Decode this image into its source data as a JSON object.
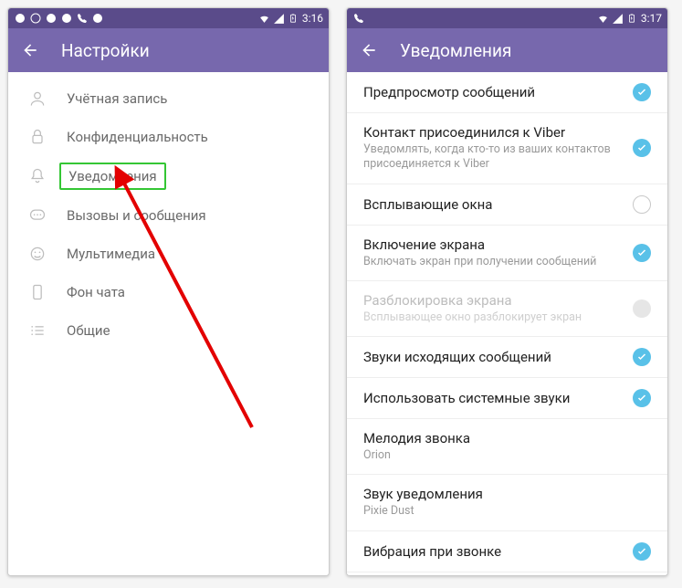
{
  "left": {
    "status_time": "3:16",
    "title": "Настройки",
    "items": [
      {
        "icon": "user",
        "label": "Учётная запись"
      },
      {
        "icon": "lock",
        "label": "Конфиденциальность"
      },
      {
        "icon": "bell",
        "label": "Уведомления",
        "highlighted": true
      },
      {
        "icon": "chat",
        "label": "Вызовы и сообщения"
      },
      {
        "icon": "media",
        "label": "Мультимедиа"
      },
      {
        "icon": "phone-bg",
        "label": "Фон чата"
      },
      {
        "icon": "list",
        "label": "Общие"
      }
    ]
  },
  "right": {
    "status_time": "3:17",
    "title": "Уведомления",
    "rows": [
      {
        "title": "Предпросмотр сообщений",
        "state": "on"
      },
      {
        "title": "Контакт присоединился к Viber",
        "sub": "Уведомлять, когда кто-то из ваших контактов присоединяется к Viber",
        "state": "on"
      },
      {
        "title": "Всплывающие окна",
        "state": "off"
      },
      {
        "title": "Включение экрана",
        "sub": "Включать экран при получении сообщений",
        "state": "on"
      },
      {
        "title": "Разблокировка экрана",
        "sub": "Всплывающее окно разблокирует экран",
        "state": "off-disabled",
        "disabled": true
      },
      {
        "title": "Звуки исходящих сообщений",
        "state": "on"
      },
      {
        "title": "Использовать системные звуки",
        "state": "on"
      },
      {
        "title": "Мелодия звонка",
        "sub": "Orion",
        "state": "none"
      },
      {
        "title": "Звук уведомления",
        "sub": "Pixie Dust",
        "state": "none"
      },
      {
        "title": "Вибрация при звонке",
        "state": "on"
      }
    ]
  }
}
